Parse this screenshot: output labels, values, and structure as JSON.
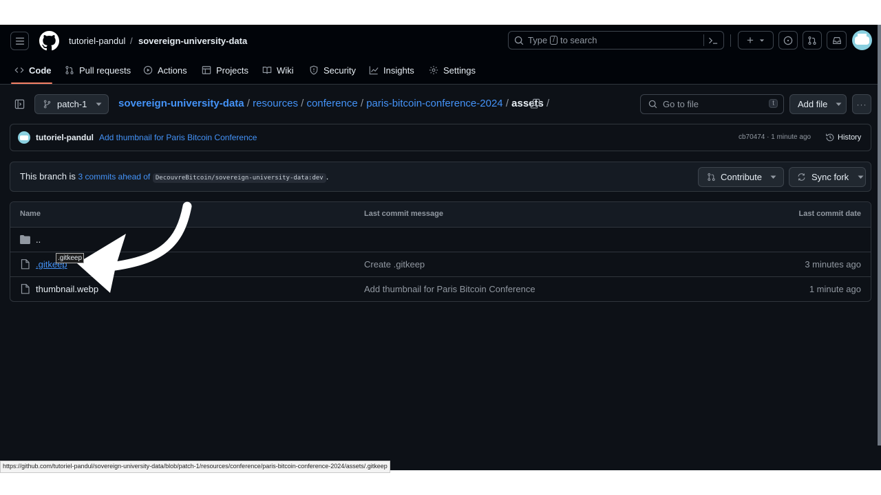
{
  "header": {
    "owner": "tutoriel-pandul",
    "separator": "/",
    "repo": "sovereign-university-data",
    "search": {
      "prefix": "Type",
      "key": "/",
      "suffix": "to search"
    },
    "plus_label": "+"
  },
  "nav": {
    "tabs": [
      {
        "label": "Code",
        "icon": "code-icon"
      },
      {
        "label": "Pull requests",
        "icon": "git-pull-request-icon"
      },
      {
        "label": "Actions",
        "icon": "play-icon"
      },
      {
        "label": "Projects",
        "icon": "table-icon"
      },
      {
        "label": "Wiki",
        "icon": "book-icon"
      },
      {
        "label": "Security",
        "icon": "shield-icon"
      },
      {
        "label": "Insights",
        "icon": "graph-icon"
      },
      {
        "label": "Settings",
        "icon": "gear-icon"
      }
    ],
    "active": "Code"
  },
  "toolbar": {
    "branch": "patch-1",
    "breadcrumb": {
      "repo": "sovereign-university-data",
      "parts": [
        "resources",
        "conference",
        "paris-bitcoin-conference-2024"
      ],
      "current": "assets",
      "sep": "/"
    },
    "goto_placeholder": "Go to file",
    "goto_key": "t",
    "add_file": "Add file",
    "more": "···"
  },
  "commit": {
    "author": "tutoriel-pandul",
    "message": "Add thumbnail for Paris Bitcoin Conference",
    "meta": "cb70474 · 1 minute ago",
    "history": "History"
  },
  "branch_status": {
    "prefix": "This branch is",
    "ahead": "3 commits ahead of",
    "upstream": "DecouvreBitcoin/sovereign-university-data:dev",
    "suffix": ".",
    "contribute": "Contribute",
    "sync": "Sync fork"
  },
  "files": {
    "columns": [
      "Name",
      "Last commit message",
      "Last commit date"
    ],
    "parent": "..",
    "rows": [
      {
        "name": ".gitkeep",
        "message": "Create .gitkeep",
        "date": "3 minutes ago"
      },
      {
        "name": "thumbnail.webp",
        "message": "Add thumbnail for Paris Bitcoin Conference",
        "date": "1 minute ago"
      }
    ]
  },
  "tooltip": ".gitkeep",
  "status_url": "https://github.com/tutoriel-pandul/sovereign-university-data/blob/patch-1/resources/conference/paris-bitcoin-conference-2024/assets/.gitkeep",
  "colors": {
    "accent": "#4493f8",
    "tab_underline": "#f78166",
    "background": "#0d1117"
  }
}
